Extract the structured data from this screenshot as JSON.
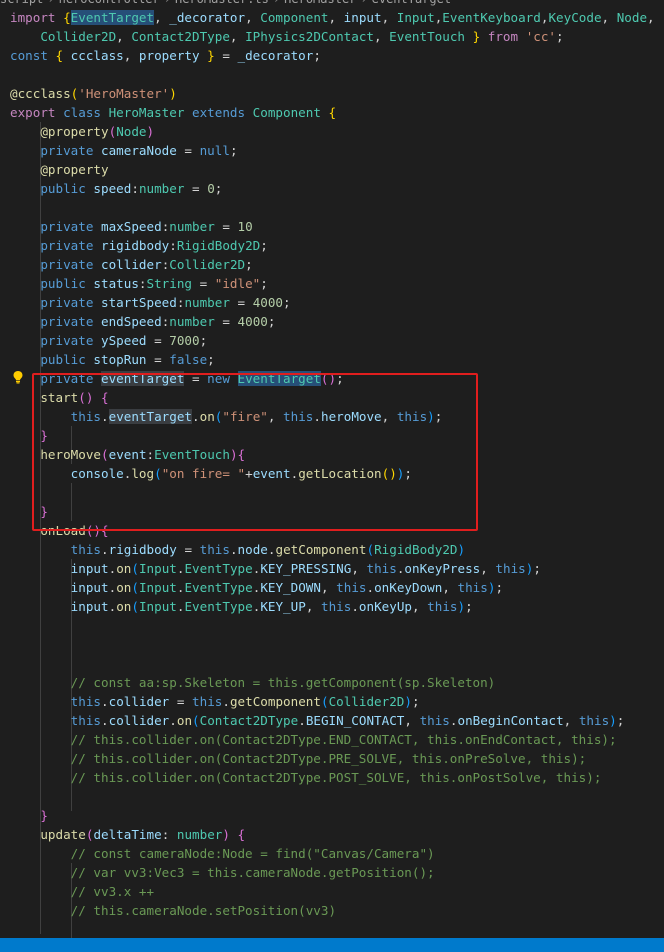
{
  "breadcrumb": {
    "items": [
      "script",
      "heroController",
      "HeroMaster.ts",
      "HeroMaster",
      "eventTarget"
    ]
  },
  "code": [
    [
      [
        "kw",
        "import "
      ],
      [
        "br1",
        "{"
      ],
      [
        "hl ty",
        "EventTarget"
      ],
      [
        "pl",
        ", "
      ],
      [
        "va",
        "_decorator"
      ],
      [
        "pl",
        ", "
      ],
      [
        "ty",
        "Component"
      ],
      [
        "pl",
        ", "
      ],
      [
        "va",
        "input"
      ],
      [
        "pl",
        ", "
      ],
      [
        "ty",
        "Input"
      ],
      [
        "pl",
        ","
      ],
      [
        "ty",
        "EventKeyboard"
      ],
      [
        "pl",
        ","
      ],
      [
        "ty",
        "KeyCode"
      ],
      [
        "pl",
        ", "
      ],
      [
        "ty",
        "Node"
      ],
      [
        "pl",
        ","
      ]
    ],
    [
      [
        "pl",
        "    "
      ],
      [
        "ty",
        "Collider2D"
      ],
      [
        "pl",
        ", "
      ],
      [
        "ty",
        "Contact2DType"
      ],
      [
        "pl",
        ", "
      ],
      [
        "ty",
        "IPhysics2DContact"
      ],
      [
        "pl",
        ", "
      ],
      [
        "ty",
        "EventTouch"
      ],
      [
        "pl",
        " "
      ],
      [
        "br1",
        "}"
      ],
      [
        "kw",
        " from "
      ],
      [
        "st",
        "'cc'"
      ],
      [
        "pl",
        ";"
      ]
    ],
    [
      [
        "kb",
        "const "
      ],
      [
        "br1",
        "{ "
      ],
      [
        "va",
        "ccclass"
      ],
      [
        "pl",
        ", "
      ],
      [
        "va",
        "property"
      ],
      [
        "br1",
        " }"
      ],
      [
        "pl",
        " = "
      ],
      [
        "va",
        "_decorator"
      ],
      [
        "pl",
        ";"
      ]
    ],
    [],
    [
      [
        "fn",
        "@ccclass"
      ],
      [
        "br1",
        "("
      ],
      [
        "st",
        "'HeroMaster'"
      ],
      [
        "br1",
        ")"
      ]
    ],
    [
      [
        "kw",
        "export "
      ],
      [
        "kb",
        "class "
      ],
      [
        "ty",
        "HeroMaster "
      ],
      [
        "kb",
        "extends "
      ],
      [
        "ty",
        "Component "
      ],
      [
        "br1",
        "{"
      ]
    ],
    [
      [
        "pl",
        "    "
      ],
      [
        "fn",
        "@property"
      ],
      [
        "br2",
        "("
      ],
      [
        "ty",
        "Node"
      ],
      [
        "br2",
        ")"
      ]
    ],
    [
      [
        "pl",
        "    "
      ],
      [
        "kb",
        "private "
      ],
      [
        "va",
        "cameraNode"
      ],
      [
        "pl",
        " = "
      ],
      [
        "kb",
        "null"
      ],
      [
        "pl",
        ";"
      ]
    ],
    [
      [
        "pl",
        "    "
      ],
      [
        "fn",
        "@property"
      ]
    ],
    [
      [
        "pl",
        "    "
      ],
      [
        "kb",
        "public "
      ],
      [
        "va",
        "speed"
      ],
      [
        "pl",
        ":"
      ],
      [
        "ty",
        "number"
      ],
      [
        "pl",
        " = "
      ],
      [
        "nu",
        "0"
      ],
      [
        "pl",
        ";"
      ]
    ],
    [],
    [
      [
        "pl",
        "    "
      ],
      [
        "kb",
        "private "
      ],
      [
        "va",
        "maxSpeed"
      ],
      [
        "pl",
        ":"
      ],
      [
        "ty",
        "number"
      ],
      [
        "pl",
        " = "
      ],
      [
        "nu",
        "10"
      ]
    ],
    [
      [
        "pl",
        "    "
      ],
      [
        "kb",
        "private "
      ],
      [
        "va",
        "rigidbody"
      ],
      [
        "pl",
        ":"
      ],
      [
        "ty",
        "RigidBody2D"
      ],
      [
        "pl",
        ";"
      ]
    ],
    [
      [
        "pl",
        "    "
      ],
      [
        "kb",
        "private "
      ],
      [
        "va",
        "collider"
      ],
      [
        "pl",
        ":"
      ],
      [
        "ty",
        "Collider2D"
      ],
      [
        "pl",
        ";"
      ]
    ],
    [
      [
        "pl",
        "    "
      ],
      [
        "kb",
        "public "
      ],
      [
        "va",
        "status"
      ],
      [
        "pl",
        ":"
      ],
      [
        "ty",
        "String"
      ],
      [
        "pl",
        " = "
      ],
      [
        "st",
        "\"idle\""
      ],
      [
        "pl",
        ";"
      ]
    ],
    [
      [
        "pl",
        "    "
      ],
      [
        "kb",
        "private "
      ],
      [
        "va",
        "startSpeed"
      ],
      [
        "pl",
        ":"
      ],
      [
        "ty",
        "number"
      ],
      [
        "pl",
        " = "
      ],
      [
        "nu",
        "4000"
      ],
      [
        "pl",
        ";"
      ]
    ],
    [
      [
        "pl",
        "    "
      ],
      [
        "kb",
        "private "
      ],
      [
        "va",
        "endSpeed"
      ],
      [
        "pl",
        ":"
      ],
      [
        "ty",
        "number"
      ],
      [
        "pl",
        " = "
      ],
      [
        "nu",
        "4000"
      ],
      [
        "pl",
        ";"
      ]
    ],
    [
      [
        "pl",
        "    "
      ],
      [
        "kb",
        "private "
      ],
      [
        "va",
        "ySpeed"
      ],
      [
        "pl",
        " = "
      ],
      [
        "nu",
        "7000"
      ],
      [
        "pl",
        ";"
      ]
    ],
    [
      [
        "pl",
        "    "
      ],
      [
        "kb",
        "public "
      ],
      [
        "va",
        "stopRun"
      ],
      [
        "pl",
        " = "
      ],
      [
        "kb",
        "false"
      ],
      [
        "pl",
        ";"
      ]
    ],
    [
      [
        "pl",
        "    "
      ],
      [
        "kb",
        "private "
      ],
      [
        "hlw va",
        "eventTarget"
      ],
      [
        "pl",
        " = "
      ],
      [
        "kb",
        "new "
      ],
      [
        "hl ty",
        "EventTarget"
      ],
      [
        "br2",
        "()"
      ],
      [
        "pl",
        ";"
      ]
    ],
    [
      [
        "pl",
        "    "
      ],
      [
        "fn",
        "start"
      ],
      [
        "br2",
        "() {"
      ]
    ],
    [
      [
        "pl",
        "        "
      ],
      [
        "kb",
        "this"
      ],
      [
        "pl",
        "."
      ],
      [
        "hlw va",
        "eventTarget"
      ],
      [
        "pl",
        "."
      ],
      [
        "fn",
        "on"
      ],
      [
        "br3",
        "("
      ],
      [
        "st",
        "\"fire\""
      ],
      [
        "pl",
        ", "
      ],
      [
        "kb",
        "this"
      ],
      [
        "pl",
        "."
      ],
      [
        "va",
        "heroMove"
      ],
      [
        "pl",
        ", "
      ],
      [
        "kb",
        "this"
      ],
      [
        "br3",
        ")"
      ],
      [
        "pl",
        ";"
      ]
    ],
    [
      [
        "pl",
        "    "
      ],
      [
        "br2",
        "}"
      ]
    ],
    [
      [
        "pl",
        "    "
      ],
      [
        "fn",
        "heroMove"
      ],
      [
        "br2",
        "("
      ],
      [
        "va",
        "event"
      ],
      [
        "pl",
        ":"
      ],
      [
        "ty",
        "EventTouch"
      ],
      [
        "br2",
        ")"
      ],
      [
        "br2",
        "{"
      ]
    ],
    [
      [
        "pl",
        "        "
      ],
      [
        "va",
        "console"
      ],
      [
        "pl",
        "."
      ],
      [
        "fn",
        "log"
      ],
      [
        "br3",
        "("
      ],
      [
        "st",
        "\"on fire= \""
      ],
      [
        "pl",
        "+"
      ],
      [
        "va",
        "event"
      ],
      [
        "pl",
        "."
      ],
      [
        "fn",
        "getLocation"
      ],
      [
        "br1",
        "()"
      ],
      [
        "br3",
        ")"
      ],
      [
        "pl",
        ";"
      ]
    ],
    [],
    [
      [
        "pl",
        "    "
      ],
      [
        "br2",
        "}"
      ]
    ],
    [
      [
        "pl",
        "    "
      ],
      [
        "fn",
        "onLoad"
      ],
      [
        "br2",
        "(){"
      ]
    ],
    [
      [
        "pl",
        "        "
      ],
      [
        "kb",
        "this"
      ],
      [
        "pl",
        "."
      ],
      [
        "va",
        "rigidbody"
      ],
      [
        "pl",
        " = "
      ],
      [
        "kb",
        "this"
      ],
      [
        "pl",
        "."
      ],
      [
        "va",
        "node"
      ],
      [
        "pl",
        "."
      ],
      [
        "fn",
        "getComponent"
      ],
      [
        "br3",
        "("
      ],
      [
        "ty",
        "RigidBody2D"
      ],
      [
        "br3",
        ")"
      ]
    ],
    [
      [
        "pl",
        "        "
      ],
      [
        "va",
        "input"
      ],
      [
        "pl",
        "."
      ],
      [
        "fn",
        "on"
      ],
      [
        "br3",
        "("
      ],
      [
        "ty",
        "Input"
      ],
      [
        "pl",
        "."
      ],
      [
        "ty",
        "EventType"
      ],
      [
        "pl",
        "."
      ],
      [
        "va",
        "KEY_PRESSING"
      ],
      [
        "pl",
        ", "
      ],
      [
        "kb",
        "this"
      ],
      [
        "pl",
        "."
      ],
      [
        "va",
        "onKeyPress"
      ],
      [
        "pl",
        ", "
      ],
      [
        "kb",
        "this"
      ],
      [
        "br3",
        ")"
      ],
      [
        "pl",
        ";"
      ]
    ],
    [
      [
        "pl",
        "        "
      ],
      [
        "va",
        "input"
      ],
      [
        "pl",
        "."
      ],
      [
        "fn",
        "on"
      ],
      [
        "br3",
        "("
      ],
      [
        "ty",
        "Input"
      ],
      [
        "pl",
        "."
      ],
      [
        "ty",
        "EventType"
      ],
      [
        "pl",
        "."
      ],
      [
        "va",
        "KEY_DOWN"
      ],
      [
        "pl",
        ", "
      ],
      [
        "kb",
        "this"
      ],
      [
        "pl",
        "."
      ],
      [
        "va",
        "onKeyDown"
      ],
      [
        "pl",
        ", "
      ],
      [
        "kb",
        "this"
      ],
      [
        "br3",
        ")"
      ],
      [
        "pl",
        ";"
      ]
    ],
    [
      [
        "pl",
        "        "
      ],
      [
        "va",
        "input"
      ],
      [
        "pl",
        "."
      ],
      [
        "fn",
        "on"
      ],
      [
        "br3",
        "("
      ],
      [
        "ty",
        "Input"
      ],
      [
        "pl",
        "."
      ],
      [
        "ty",
        "EventType"
      ],
      [
        "pl",
        "."
      ],
      [
        "va",
        "KEY_UP"
      ],
      [
        "pl",
        ", "
      ],
      [
        "kb",
        "this"
      ],
      [
        "pl",
        "."
      ],
      [
        "va",
        "onKeyUp"
      ],
      [
        "pl",
        ", "
      ],
      [
        "kb",
        "this"
      ],
      [
        "br3",
        ")"
      ],
      [
        "pl",
        ";"
      ]
    ],
    [],
    [],
    [],
    [
      [
        "pl",
        "        "
      ],
      [
        "cm",
        "// const aa:sp.Skeleton = this.getComponent(sp.Skeleton)"
      ]
    ],
    [
      [
        "pl",
        "        "
      ],
      [
        "kb",
        "this"
      ],
      [
        "pl",
        "."
      ],
      [
        "va",
        "collider"
      ],
      [
        "pl",
        " = "
      ],
      [
        "kb",
        "this"
      ],
      [
        "pl",
        "."
      ],
      [
        "fn",
        "getComponent"
      ],
      [
        "br3",
        "("
      ],
      [
        "ty",
        "Collider2D"
      ],
      [
        "br3",
        ")"
      ],
      [
        "pl",
        ";"
      ]
    ],
    [
      [
        "pl",
        "        "
      ],
      [
        "kb",
        "this"
      ],
      [
        "pl",
        "."
      ],
      [
        "va",
        "collider"
      ],
      [
        "pl",
        "."
      ],
      [
        "fn",
        "on"
      ],
      [
        "br3",
        "("
      ],
      [
        "ty",
        "Contact2DType"
      ],
      [
        "pl",
        "."
      ],
      [
        "va",
        "BEGIN_CONTACT"
      ],
      [
        "pl",
        ", "
      ],
      [
        "kb",
        "this"
      ],
      [
        "pl",
        "."
      ],
      [
        "va",
        "onBeginContact"
      ],
      [
        "pl",
        ", "
      ],
      [
        "kb",
        "this"
      ],
      [
        "br3",
        ")"
      ],
      [
        "pl",
        ";"
      ]
    ],
    [
      [
        "pl",
        "        "
      ],
      [
        "cm",
        "// this.collider.on(Contact2DType.END_CONTACT, this.onEndContact, this);"
      ]
    ],
    [
      [
        "pl",
        "        "
      ],
      [
        "cm",
        "// this.collider.on(Contact2DType.PRE_SOLVE, this.onPreSolve, this);"
      ]
    ],
    [
      [
        "pl",
        "        "
      ],
      [
        "cm",
        "// this.collider.on(Contact2DType.POST_SOLVE, this.onPostSolve, this);"
      ]
    ],
    [],
    [
      [
        "pl",
        "    "
      ],
      [
        "br2",
        "}"
      ]
    ],
    [
      [
        "pl",
        "    "
      ],
      [
        "fn",
        "update"
      ],
      [
        "br2",
        "("
      ],
      [
        "va",
        "deltaTime"
      ],
      [
        "pl",
        ": "
      ],
      [
        "ty",
        "number"
      ],
      [
        "br2",
        ")"
      ],
      [
        "pl",
        " "
      ],
      [
        "br2",
        "{"
      ]
    ],
    [
      [
        "pl",
        "        "
      ],
      [
        "cm",
        "// const cameraNode:Node = find(\"Canvas/Camera\")"
      ]
    ],
    [
      [
        "pl",
        "        "
      ],
      [
        "cm",
        "// var vv3:Vec3 = this.cameraNode.getPosition();"
      ]
    ],
    [
      [
        "pl",
        "        "
      ],
      [
        "cm",
        "// vv3.x ++"
      ]
    ],
    [
      [
        "pl",
        "        "
      ],
      [
        "cm",
        "// this.cameraNode.setPosition(vv3)"
      ]
    ]
  ]
}
